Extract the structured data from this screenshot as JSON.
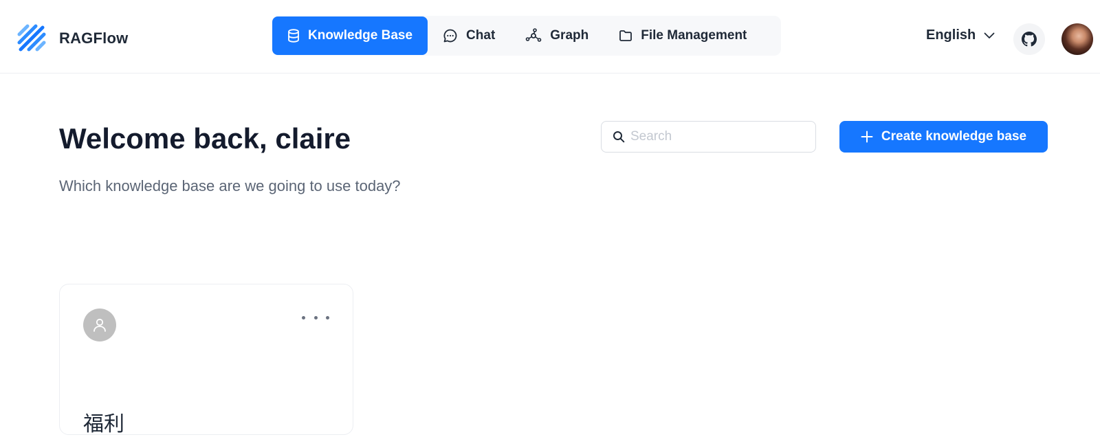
{
  "app": {
    "name": "RAGFlow"
  },
  "nav": {
    "tabs": [
      {
        "label": "Knowledge Base",
        "icon": "database-icon",
        "active": true
      },
      {
        "label": "Chat",
        "icon": "chat-icon",
        "active": false
      },
      {
        "label": "Graph",
        "icon": "graph-icon",
        "active": false
      },
      {
        "label": "File Management",
        "icon": "folder-icon",
        "active": false
      }
    ]
  },
  "header": {
    "language": "English"
  },
  "main": {
    "title": "Welcome back, claire",
    "subtitle": "Which knowledge base are we going to use today?",
    "search_placeholder": "Search",
    "create_label": "Create knowledge base"
  },
  "cards": [
    {
      "name": "福利"
    }
  ],
  "colors": {
    "accent": "#1677ff",
    "text": "#141b2d",
    "muted": "#5b6575"
  }
}
